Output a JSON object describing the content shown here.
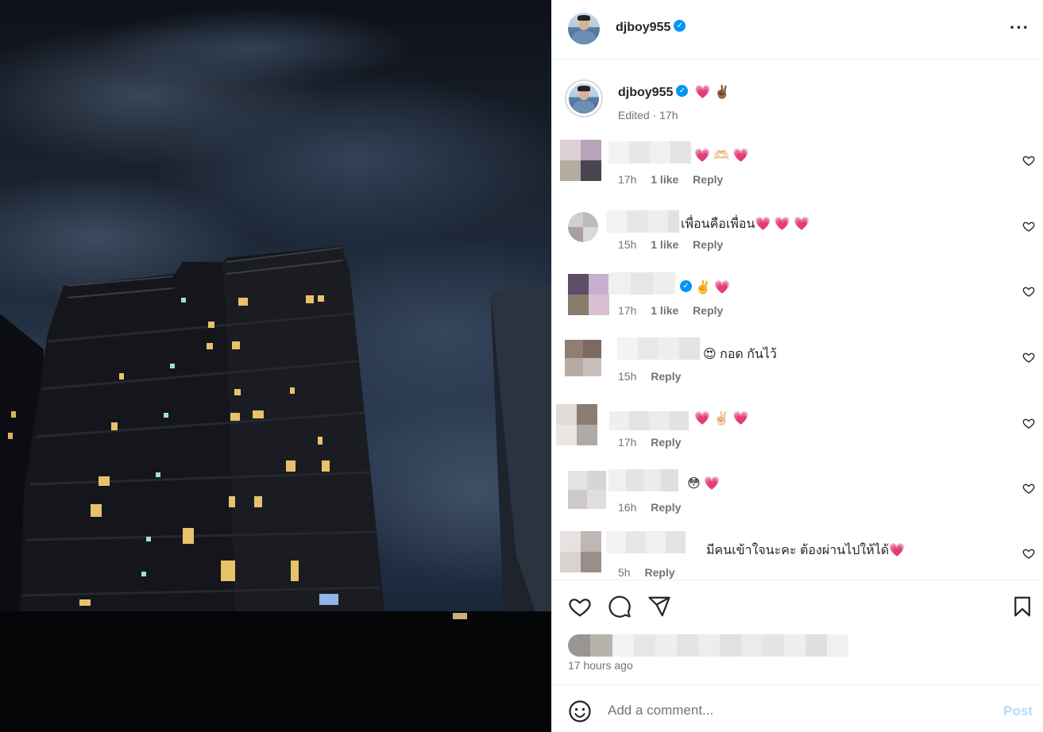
{
  "header": {
    "username": "djboy955",
    "more_label": "···"
  },
  "caption": {
    "username": "djboy955",
    "emojis": "💗 ✌🏾",
    "meta": "Edited · 17h"
  },
  "comments": [
    {
      "text": "💗 🫶🏻 💗",
      "time": "17h",
      "likes": "1 like",
      "reply": "Reply"
    },
    {
      "text": "เพื่อนคือเพื่อน💗 💗 💗",
      "time": "15h",
      "likes": "1 like",
      "reply": "Reply"
    },
    {
      "text": "✌️ 💗",
      "time": "17h",
      "likes": "1 like",
      "reply": "Reply"
    },
    {
      "text": "😍 กอด กันไว้",
      "time": "15h",
      "reply": "Reply"
    },
    {
      "text": "💗 ✌🏻 💗",
      "time": "17h",
      "reply": "Reply"
    },
    {
      "text": "😳 💗",
      "time": "16h",
      "reply": "Reply"
    },
    {
      "text": "มีคนเข้าใจนะคะ ต้องผ่านไปให้ได้💗",
      "time": "5h",
      "reply": "Reply"
    }
  ],
  "post": {
    "time_ago": "17 hours ago"
  },
  "composer": {
    "placeholder": "Add a comment...",
    "post_label": "Post"
  },
  "colors": {
    "verified": "#0095f6",
    "post_button": "#b3dbff",
    "meta_gray": "#737373"
  }
}
